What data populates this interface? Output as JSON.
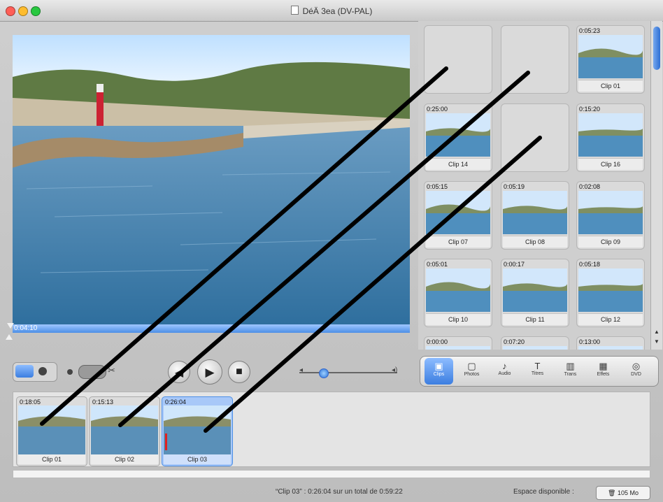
{
  "window": {
    "title": "DéÄ 3ea (DV-PAL)"
  },
  "viewer": {
    "timecode": "0:04:10"
  },
  "clip_shelf": {
    "clips": [
      {
        "timecode": "0:05:23",
        "name": "Clip 01"
      },
      {
        "timecode": "0:25:00",
        "name": "Clip 14"
      },
      {
        "timecode": "0:15:20",
        "name": "Clip 16"
      },
      {
        "timecode": "0:05:15",
        "name": "Clip 07"
      },
      {
        "timecode": "0:05:19",
        "name": "Clip 08"
      },
      {
        "timecode": "0:02:08",
        "name": "Clip 09"
      },
      {
        "timecode": "0:05:01",
        "name": "Clip 10"
      },
      {
        "timecode": "0:00:17",
        "name": "Clip 11"
      },
      {
        "timecode": "0:05:18",
        "name": "Clip 12"
      },
      {
        "timecode": "0:00:00",
        "name": ""
      },
      {
        "timecode": "0:07:20",
        "name": ""
      },
      {
        "timecode": "0:13:00",
        "name": ""
      }
    ]
  },
  "palette": {
    "buttons": [
      {
        "label": "Clips",
        "icon": "clips-icon",
        "glyph": "▣",
        "selected": true
      },
      {
        "label": "Photos",
        "icon": "photos-icon",
        "glyph": "▢"
      },
      {
        "label": "Audio",
        "icon": "audio-icon",
        "glyph": "♪"
      },
      {
        "label": "Titres",
        "icon": "titles-icon",
        "glyph": "T"
      },
      {
        "label": "Trans",
        "icon": "transitions-icon",
        "glyph": "▥"
      },
      {
        "label": "Effets",
        "icon": "effects-icon",
        "glyph": "▦"
      },
      {
        "label": "DVD",
        "icon": "dvd-icon",
        "glyph": "◎"
      }
    ]
  },
  "timeline": {
    "clips": [
      {
        "timecode": "0:18:05",
        "name": "Clip 01"
      },
      {
        "timecode": "0:15:13",
        "name": "Clip 02"
      },
      {
        "timecode": "0:26:04",
        "name": "Clip 03",
        "selected": true
      }
    ]
  },
  "status": {
    "message": "“Clip 03” : 0:26:04 sur un total de 0:59:22",
    "disk_label": "Espace disponible :",
    "disk_value": "105 Mo"
  },
  "colors": {
    "accent": "#3c7ee0",
    "window_bg": "#c8c8c8"
  }
}
